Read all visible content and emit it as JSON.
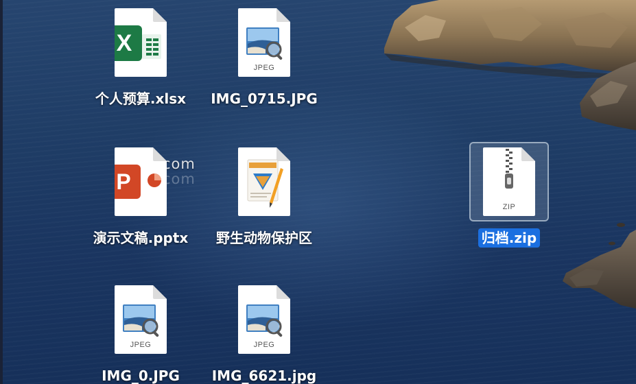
{
  "watermark": "Macv.com",
  "desktop": {
    "files": [
      {
        "label": "个人预算.xlsx",
        "icon": "excel-icon",
        "type_label": ""
      },
      {
        "label": "IMG_0715.JPG",
        "icon": "jpeg-preview-icon",
        "type_label": "JPEG"
      },
      {
        "label": "演示文稿.pptx",
        "icon": "powerpoint-icon",
        "type_label": ""
      },
      {
        "label": "野生动物保护区",
        "icon": "pages-document-icon",
        "type_label": ""
      },
      {
        "label": "归档.zip",
        "icon": "zip-archive-icon",
        "type_label": "ZIP",
        "selected": true
      },
      {
        "label": "IMG_0.JPG",
        "icon": "jpeg-preview-icon",
        "type_label": "JPEG"
      },
      {
        "label": "IMG_6621.jpg",
        "icon": "jpeg-preview-icon",
        "type_label": "JPEG"
      }
    ]
  },
  "colors": {
    "excel_green": "#1d7a45",
    "powerpoint_orange": "#d24726",
    "selection_blue": "#1b6fe0"
  }
}
